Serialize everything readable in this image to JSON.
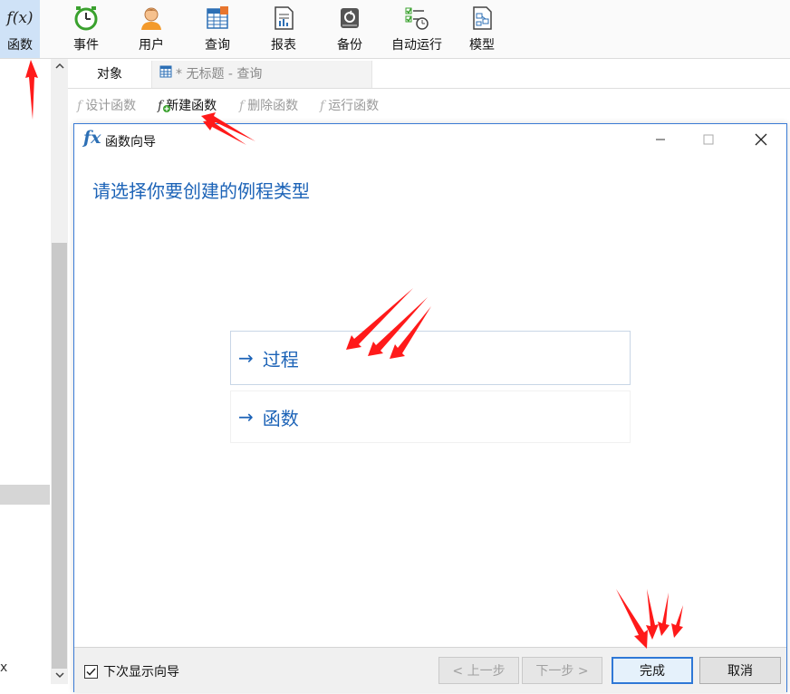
{
  "ribbon": {
    "items": [
      {
        "label": "函数",
        "icon": "function-icon",
        "active": true
      },
      {
        "label": "事件",
        "icon": "clock-icon"
      },
      {
        "label": "用户",
        "icon": "user-icon"
      },
      {
        "label": "查询",
        "icon": "query-table-icon"
      },
      {
        "label": "报表",
        "icon": "report-icon"
      },
      {
        "label": "备份",
        "icon": "backup-icon"
      },
      {
        "label": "自动运行",
        "icon": "auto-run-icon"
      },
      {
        "label": "模型",
        "icon": "model-icon"
      }
    ],
    "function_glyph": "f(x)"
  },
  "tabs": {
    "objects": "对象",
    "query_tab": "* 无标题 - 查询"
  },
  "left_pane": {
    "scroll_up": "^",
    "scroll_down": "v",
    "stray_char": "x"
  },
  "toolbar": {
    "design_function": "设计函数",
    "new_function": "新建函数",
    "delete_function": "删除函数",
    "run_function": "运行函数",
    "glyph": "f"
  },
  "dialog": {
    "title": "函数向导",
    "title_glyph": "fx",
    "heading": "请选择你要创建的例程类型",
    "arrow": "→",
    "option_procedure": "过程",
    "option_function": "函数",
    "show_wizard_next_time": "下次显示向导",
    "show_wizard_checked": true,
    "prev_button": "< 上一步",
    "next_button": "下一步 >",
    "finish_button": "完成",
    "cancel_button": "取消"
  },
  "colors": {
    "accent": "#1c63b7",
    "active_ribbon": "#cfe2f7",
    "annotation_red": "#ff1a1a"
  }
}
